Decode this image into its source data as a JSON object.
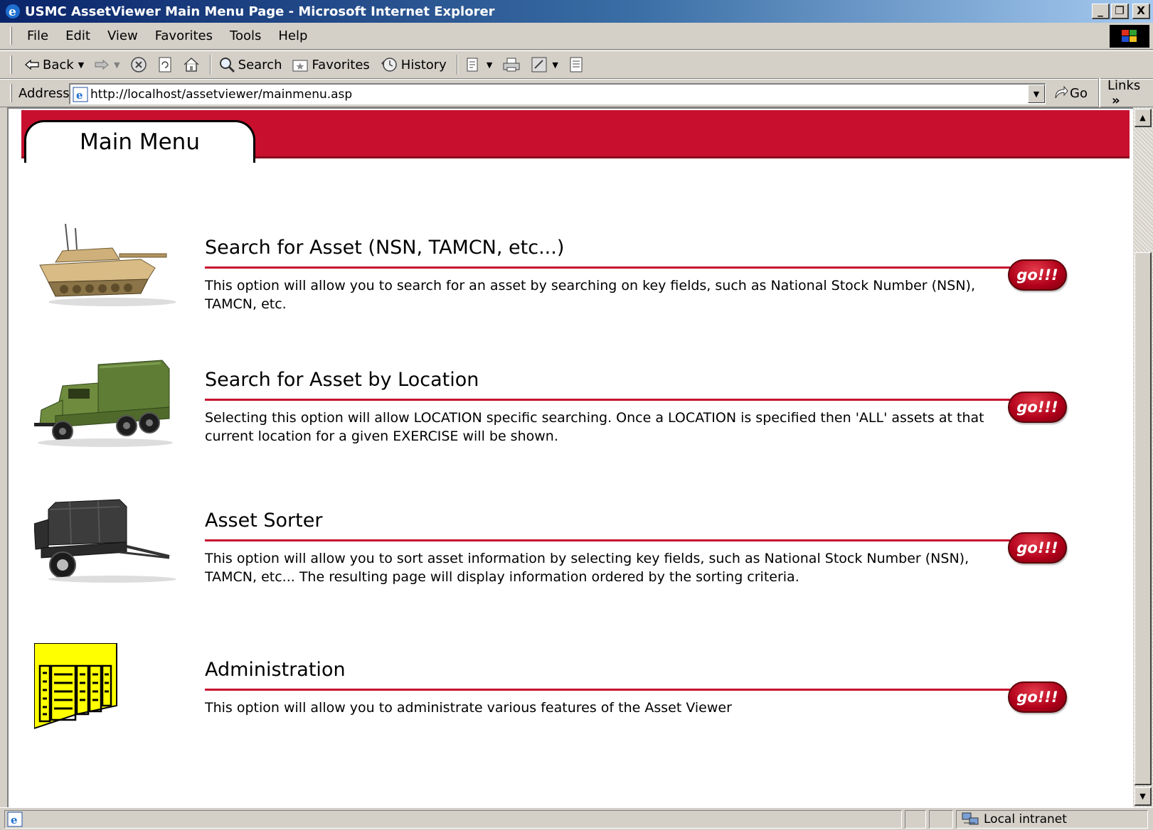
{
  "window": {
    "title": "USMC AssetViewer Main Menu Page - Microsoft Internet Explorer",
    "minimize": "_",
    "maximize": "❐",
    "close": "X"
  },
  "menu": {
    "items": [
      "File",
      "Edit",
      "View",
      "Favorites",
      "Tools",
      "Help"
    ]
  },
  "toolbar": {
    "back": "Back",
    "search": "Search",
    "favorites": "Favorites",
    "history": "History"
  },
  "address": {
    "label": "Address",
    "url": "http://localhost/assetviewer/mainmenu.asp",
    "go": "Go",
    "links": "Links",
    "chevron": "»"
  },
  "page": {
    "header_tab": "Main Menu",
    "go_label": "go!!!",
    "options": [
      {
        "title": "Search for Asset (NSN, TAMCN, etc...)",
        "desc": "This option will allow you to search for an asset by searching on key fields, such as National Stock Number (NSN), TAMCN, etc.",
        "image": "tank-image"
      },
      {
        "title": "Search for Asset by Location",
        "desc": "Selecting this option will allow LOCATION specific searching. Once a LOCATION is specified then 'ALL' assets at that current location for a given EXERCISE will be shown.",
        "image": "truck-image"
      },
      {
        "title": "Asset Sorter",
        "desc": "This option will allow you to sort asset information by selecting key fields, such as National Stock Number (NSN), TAMCN, etc... The resulting page will display information ordered by the sorting criteria.",
        "image": "trailer-image"
      },
      {
        "title": "Administration",
        "desc": "This option will allow you to administrate various features of the Asset Viewer",
        "image": "document-table-icon"
      }
    ]
  },
  "status": {
    "zone": "Local intranet"
  },
  "colors": {
    "accent_red": "#c8102e",
    "title_bar_blue": "#0a246a",
    "window_gray": "#d4d0c8",
    "admin_yellow": "#ffff00"
  }
}
